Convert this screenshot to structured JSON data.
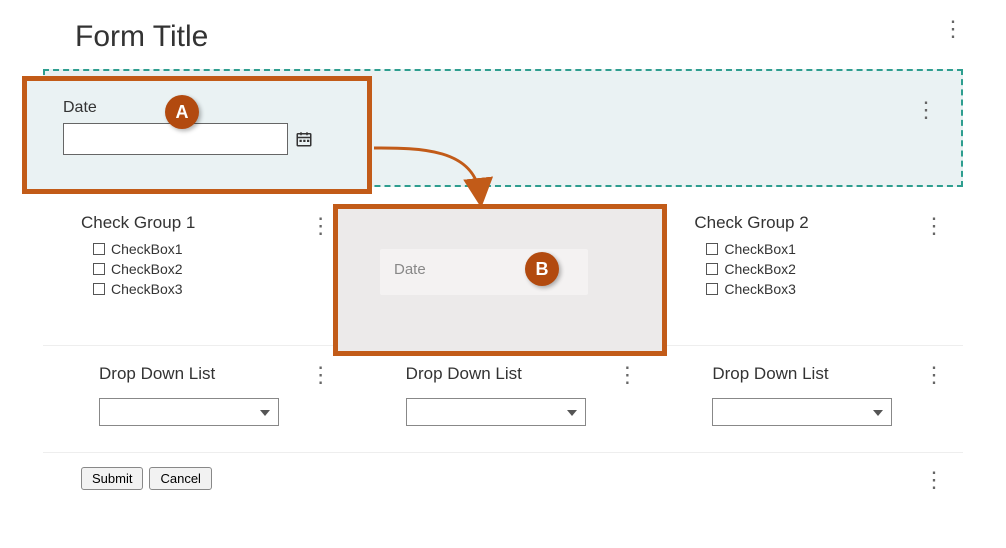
{
  "title": "Form Title",
  "annotations": {
    "a": "A",
    "b": "B"
  },
  "dateField": {
    "label": "Date"
  },
  "ghostField": {
    "label": "Date"
  },
  "checkGroups": [
    {
      "title": "Check Group 1",
      "items": [
        "CheckBox1",
        "CheckBox2",
        "CheckBox3"
      ]
    },
    {
      "title": "Check Group 2",
      "items": [
        "CheckBox1",
        "CheckBox2",
        "CheckBox3"
      ]
    }
  ],
  "dropdowns": [
    {
      "label": "Drop Down List"
    },
    {
      "label": "Drop Down List"
    },
    {
      "label": "Drop Down List"
    }
  ],
  "buttons": {
    "submit": "Submit",
    "cancel": "Cancel"
  }
}
